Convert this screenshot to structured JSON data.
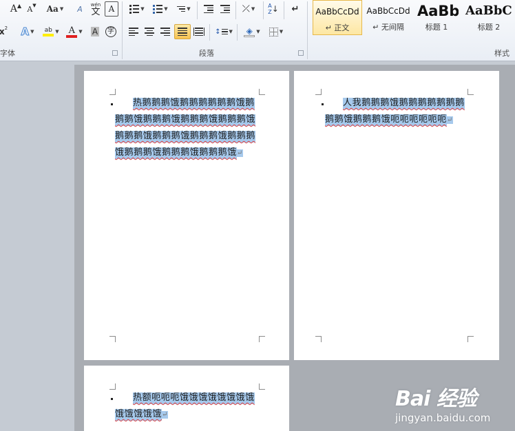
{
  "ribbon": {
    "font_group": {
      "label": "字体",
      "grow_font": "A",
      "shrink_font": "A",
      "change_case": "Aa",
      "clear_format": "A",
      "phonetic": "wén",
      "phonetic_char": "文",
      "char_border": "A",
      "superscript": "x",
      "text_effects": "A",
      "highlight": "ab",
      "font_color": "A",
      "char_shading": "A",
      "enclose_char": "字",
      "highlight_color": "#ffee00",
      "font_color_value": "#e02020"
    },
    "paragraph_group": {
      "label": "段落",
      "sort": "A",
      "sort_bottom": "Z"
    },
    "styles_group": {
      "label": "样式",
      "items": [
        {
          "preview": "AaBbCcDd",
          "name": "↵ 正文",
          "selected": true
        },
        {
          "preview": "AaBbCcDd",
          "name": "↵ 无间隔",
          "selected": false
        },
        {
          "preview": "AaBb",
          "name": "标题 1",
          "selected": false
        },
        {
          "preview": "AaBbC",
          "name": "标题 2",
          "selected": false
        }
      ]
    }
  },
  "document": {
    "pages": [
      {
        "text": "热鹅鹅鹅饿鹅鹅鹅鹅鹅鹅饿鹅鹅鹅饿鹅鹅鹅饿鹅鹅鹅饿鹅鹅鹅饿鹅鹅鹅饿鹅鹅鹅饿鹅鹅鹅饿鹅鹅鹅饿鹅鹅鹅饿鹅鹅鹅饿鹅鹅鹅饿",
        "mark": "↵"
      },
      {
        "text": "人我鹅鹅鹅饿鹅鹅鹅鹅鹅鹅鹅鹅鹅饿鹅鹅鹅饿呃呃呃呃呃呃",
        "mark": "↵"
      },
      {
        "text": "热额呃呃呃饿饿饿饿饿饿饿饿饿饿饿饿饿",
        "mark": "↵"
      }
    ]
  },
  "watermark": {
    "logo": "Bai  经验",
    "url": "jingyan.baidu.com"
  }
}
